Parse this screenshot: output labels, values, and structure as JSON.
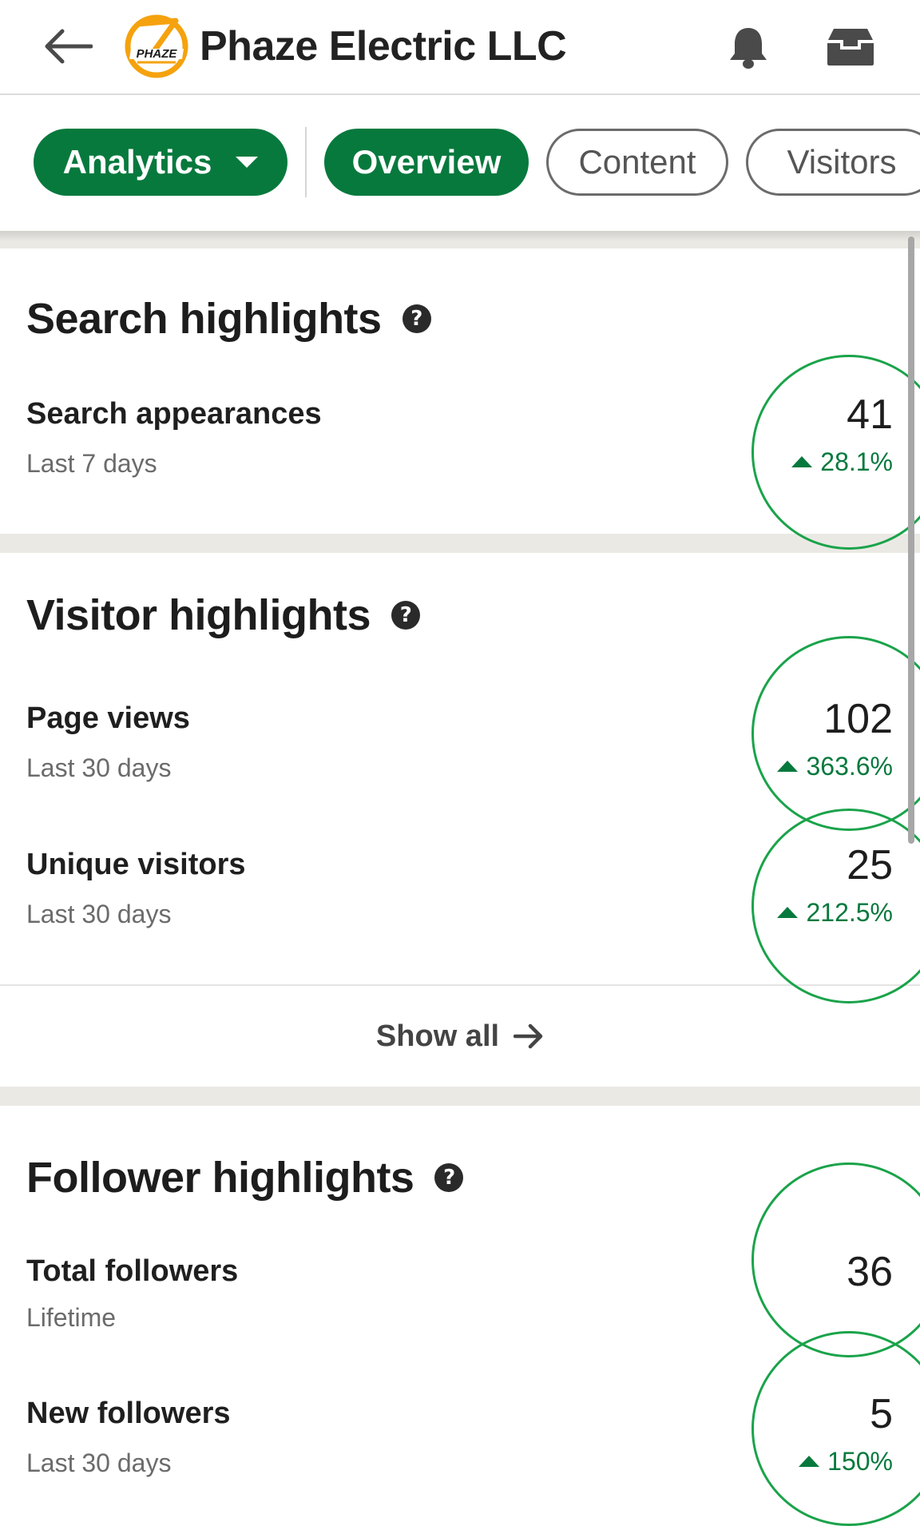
{
  "header": {
    "title": "Phaze Electric LLC",
    "logo_text": "PHAZE",
    "back_icon": "arrow-left-icon",
    "notifications_icon": "bell-icon",
    "inbox_icon": "inbox-icon"
  },
  "tabs": {
    "analytics_label": "Analytics",
    "items": [
      {
        "label": "Overview",
        "selected": true
      },
      {
        "label": "Content",
        "selected": false
      },
      {
        "label": "Visitors",
        "selected": false
      }
    ]
  },
  "search_highlights": {
    "title": "Search highlights",
    "metrics": [
      {
        "label": "Search appearances",
        "period": "Last 7 days",
        "value": "41",
        "change": "28.1%"
      }
    ]
  },
  "visitor_highlights": {
    "title": "Visitor highlights",
    "metrics": [
      {
        "label": "Page views",
        "period": "Last 30 days",
        "value": "102",
        "change": "363.6%"
      },
      {
        "label": "Unique visitors",
        "period": "Last 30 days",
        "value": "25",
        "change": "212.5%"
      }
    ],
    "show_all_label": "Show all"
  },
  "follower_highlights": {
    "title": "Follower highlights",
    "metrics": [
      {
        "label": "Total followers",
        "period": "Lifetime",
        "value": "36",
        "change": ""
      },
      {
        "label": "New followers",
        "period": "Last 30 days",
        "value": "5",
        "change": "150%"
      }
    ]
  },
  "colors": {
    "brand_green": "#07793d",
    "annotation_ring": "#1aa34a",
    "logo_orange": "#f5a20e"
  }
}
